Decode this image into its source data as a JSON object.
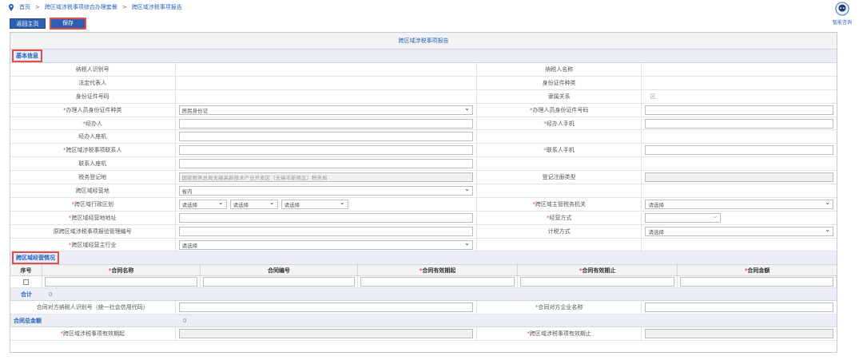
{
  "breadcrumb": [
    "首页",
    "跨区域涉税事项综合办理套餐",
    "跨区域涉税事项报告"
  ],
  "breadcrumb_sep": ">",
  "help_label": "智能咨询",
  "toolbar": {
    "back": "返回主页",
    "save": "保存"
  },
  "form_title": "跨区域涉税事项报告",
  "sections": {
    "basic": "基本信息",
    "biz": "跨区域经营情况"
  },
  "basic_rows": [
    {
      "l1": "纳税人识别号",
      "v1": "",
      "l2": "纳税人名称",
      "v2": ""
    },
    {
      "l1": "法定代表人",
      "v1": "",
      "l2": "身份证件种类",
      "v2": ""
    },
    {
      "l1": "身份证件号码",
      "v1": "",
      "l2": "隶属关系",
      "v2": "区"
    },
    {
      "l1": "办理人员身份证件种类",
      "v1": "居民身份证",
      "l2": "办理人员身份证件号码",
      "v2": ""
    },
    {
      "l1": "经办人",
      "l2": "经办人手机"
    },
    {
      "l1": "经办人座机"
    },
    {
      "l1": "跨区域涉税事项联系人",
      "l2": "联系人手机"
    },
    {
      "l1": "联系人座机"
    },
    {
      "l1": "税务登记地",
      "v1": "国家税务总局无锡高新技术产业开发区（无锡市新吴区）税务局",
      "l2": "登记注册类型"
    },
    {
      "l1": "跨区域经营地",
      "v1": "省内"
    },
    {
      "l1": "跨区域行政区划",
      "opts": [
        "请选择",
        "请选择",
        "请选择"
      ],
      "l2": "跨区域主管税务机关",
      "v2": "请选择"
    },
    {
      "l1": "跨区域经营地地址",
      "l2": "经营方式"
    },
    {
      "l1": "原跨区域涉税事项报验管理编号",
      "l2": "计税方式",
      "v2": "请选择"
    },
    {
      "l1": "跨区域经营主行业",
      "v1": "请选择"
    }
  ],
  "contract_table": {
    "headers": [
      "序号",
      "合同名称",
      "合同编号",
      "合同有效期起",
      "合同有效期止",
      "合同金额"
    ],
    "required": [
      false,
      true,
      false,
      true,
      true,
      true
    ]
  },
  "total_label": "合计",
  "total_value": "0",
  "counterparty": {
    "l1": "合同对方纳税人识别号（统一社会信用代码）",
    "l2": "合同对方企业名称"
  },
  "grand_total_label": "合同总金额",
  "grand_total_value": "0",
  "validity": {
    "l1": "跨区域涉税事项有效期起",
    "l2": "跨区域涉税事项有效期止"
  },
  "required_mark": "*",
  "colors": {
    "accent": "#2a62b8",
    "button": "#2d5fb0",
    "highlight": "#e24d4d"
  }
}
